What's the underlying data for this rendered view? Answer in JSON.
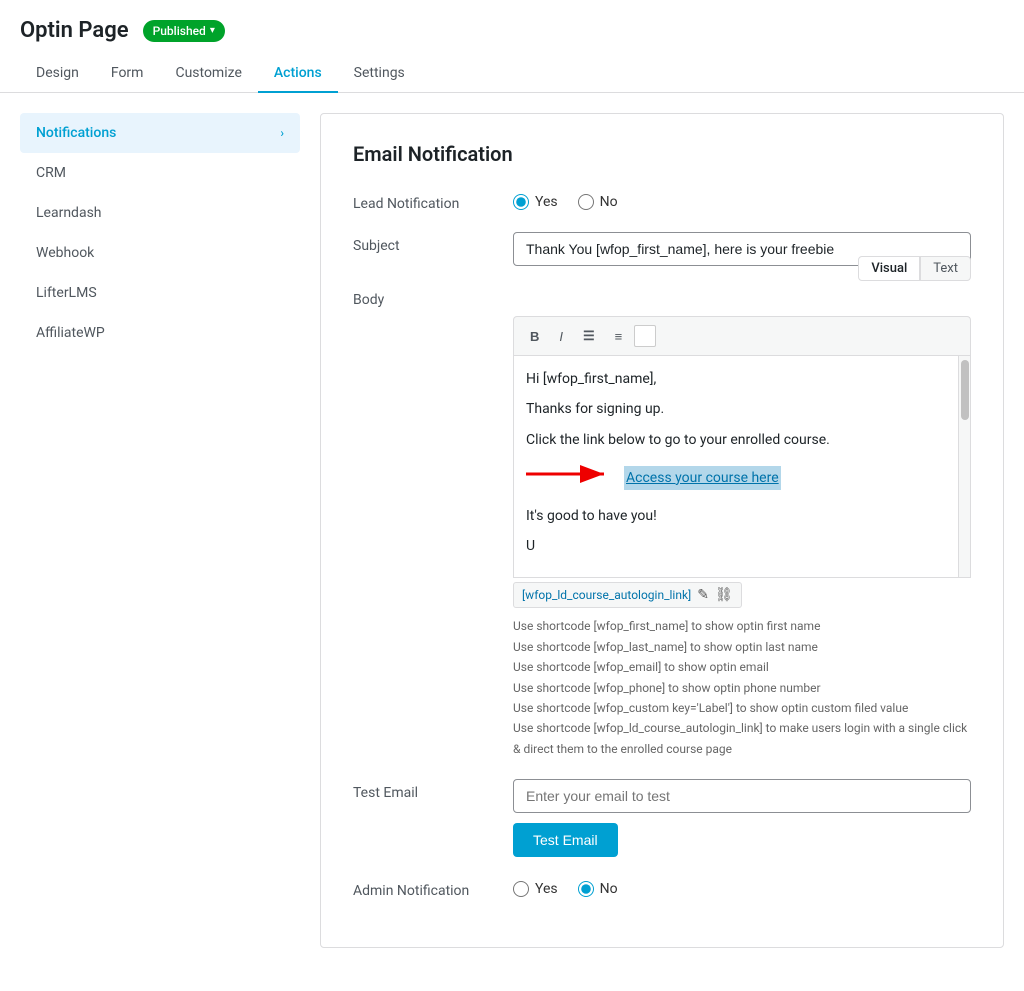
{
  "header": {
    "title": "Optin Page",
    "published_label": "Published",
    "chevron": "▾"
  },
  "nav": {
    "tabs": [
      {
        "id": "design",
        "label": "Design",
        "active": false
      },
      {
        "id": "form",
        "label": "Form",
        "active": false
      },
      {
        "id": "customize",
        "label": "Customize",
        "active": false
      },
      {
        "id": "actions",
        "label": "Actions",
        "active": true
      },
      {
        "id": "settings",
        "label": "Settings",
        "active": false
      }
    ]
  },
  "sidebar": {
    "items": [
      {
        "id": "notifications",
        "label": "Notifications",
        "active": true,
        "hasChevron": true
      },
      {
        "id": "crm",
        "label": "CRM",
        "active": false
      },
      {
        "id": "learndash",
        "label": "Learndash",
        "active": false
      },
      {
        "id": "webhook",
        "label": "Webhook",
        "active": false
      },
      {
        "id": "lifterlms",
        "label": "LifterLMS",
        "active": false
      },
      {
        "id": "affiliatewp",
        "label": "AffiliateWP",
        "active": false
      }
    ]
  },
  "content": {
    "section_title": "Email Notification",
    "lead_notification": {
      "label": "Lead Notification",
      "yes_label": "Yes",
      "no_label": "No",
      "value": "yes"
    },
    "subject": {
      "label": "Subject",
      "value": "Thank You [wfop_first_name], here is your freebie"
    },
    "body": {
      "label": "Body",
      "visual_tab": "Visual",
      "text_tab": "Text",
      "active_tab": "visual",
      "content_line1": "Hi [wfop_first_name],",
      "content_line2": "Thanks for signing up.",
      "content_line3": "Click the link below to go to your enrolled course.",
      "content_link": "Access your course here",
      "content_line4": "It's good to have you!",
      "content_partial": "U",
      "link_popup_text": "[wfop_ld_course_autologin_link]",
      "edit_icon": "✎",
      "unlink_icon": "⛓"
    },
    "hints": [
      "Use shortcode [wfop_first_name] to show optin first name",
      "Use shortcode [wfop_last_name] to show optin last name",
      "Use shortcode [wfop_email] to show optin email",
      "Use shortcode [wfop_phone] to show optin phone number",
      "Use shortcode [wfop_custom key='Label'] to show optin custom filed value",
      "Use shortcode [wfop_ld_course_autologin_link] to make users login with a single click & direct them to the enrolled course page"
    ],
    "test_email": {
      "label": "Test Email",
      "placeholder": "Enter your email to test",
      "button_label": "Test Email"
    },
    "admin_notification": {
      "label": "Admin Notification",
      "yes_label": "Yes",
      "no_label": "No",
      "value": "no"
    }
  }
}
